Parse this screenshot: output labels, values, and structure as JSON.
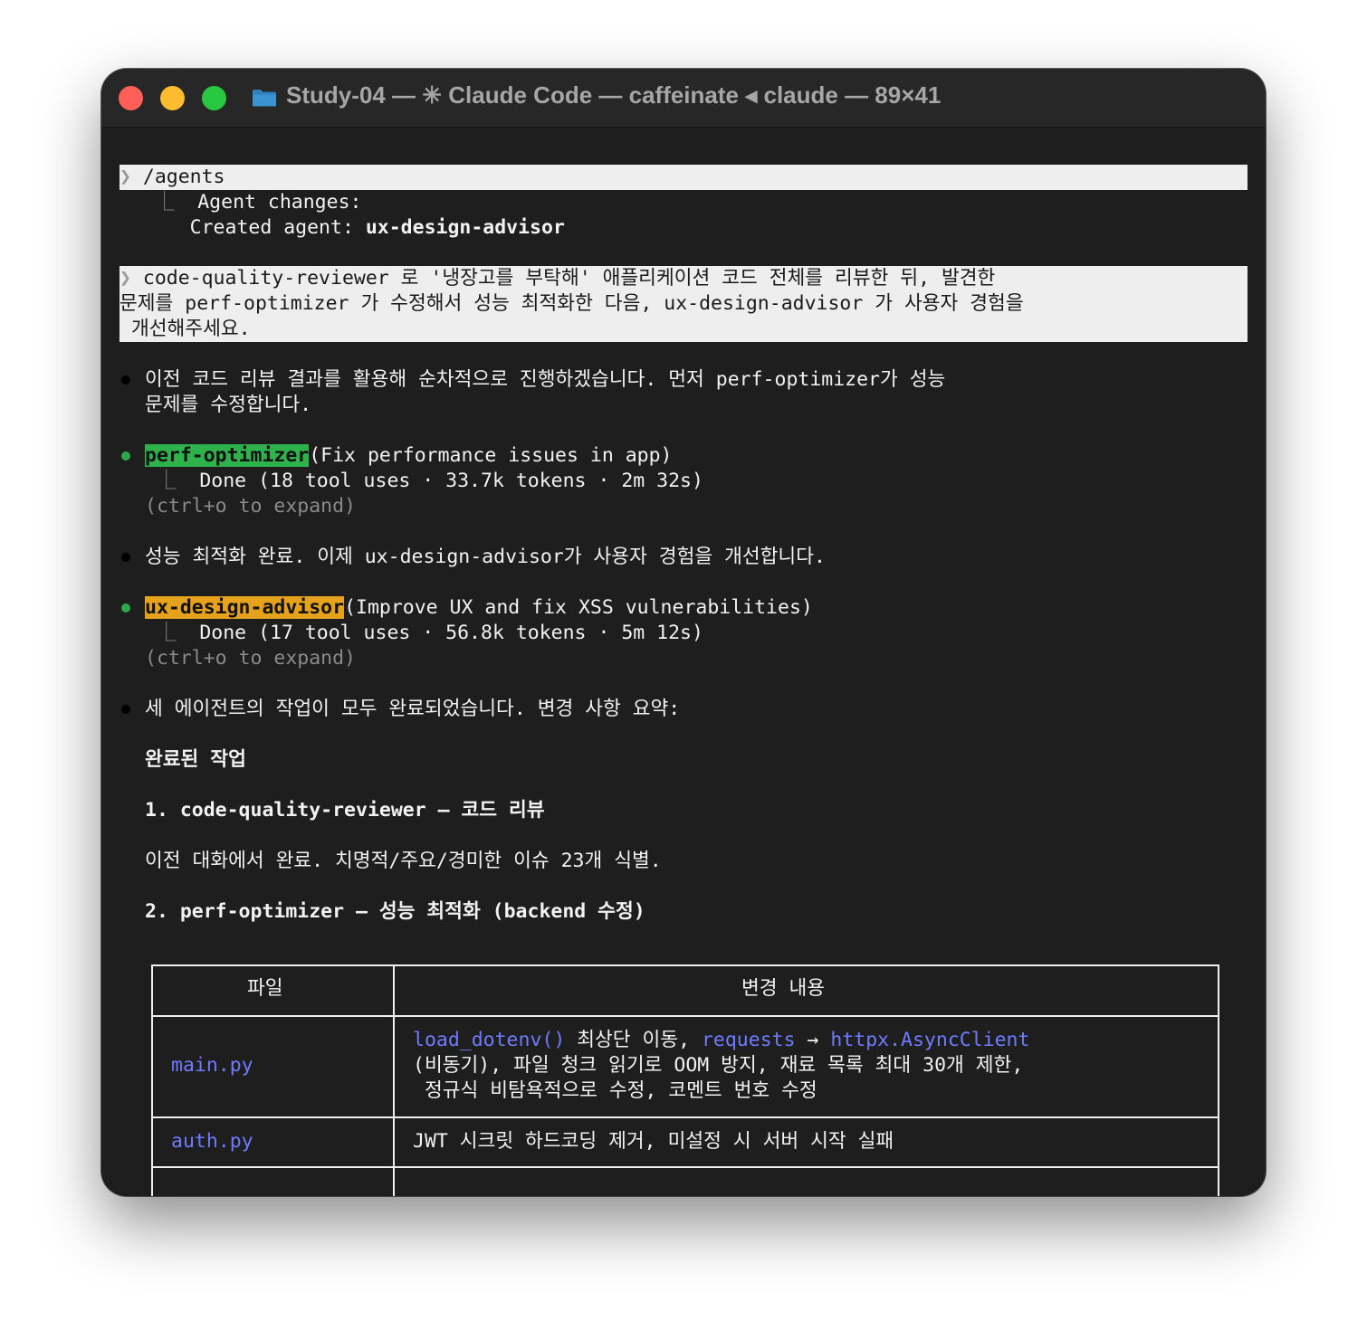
{
  "window": {
    "title": "Study-04 — ✳ Claude Code — caffeinate ◂ claude — 89×41"
  },
  "blocks": {
    "cmd1": "/agents",
    "agent_changes": "Agent changes:",
    "created_label": "Created agent: ",
    "created_name": "ux-design-advisor",
    "cmd2_l1": "code-quality-reviewer 로 '냉장고를 부탁해' 애플리케이션 코드 전체를 리뷰한 뒤, 발견한",
    "cmd2_l2": "문제를 perf-optimizer 가 수정해서 성능 최적화한 다음, ux-design-advisor 가 사용자 경험을",
    "cmd2_l3": " 개선해주세요.",
    "msg1_l1": "이전 코드 리뷰 결과를 활용해 순차적으로 진행하겠습니다. 먼저 perf-optimizer가 성능",
    "msg1_l2": "문제를 수정합니다.",
    "task1_name": "perf-optimizer",
    "task1_desc": "(Fix performance issues in app)",
    "task1_result": "Done (18 tool uses · 33.7k tokens · 2m 32s)",
    "expand_hint": "(ctrl+o to expand)",
    "msg2": "성능 최적화 완료. 이제 ux-design-advisor가 사용자 경험을 개선합니다.",
    "task2_name": "ux-design-advisor",
    "task2_desc": "(Improve UX and fix XSS vulnerabilities)",
    "task2_result": "Done (17 tool uses · 56.8k tokens · 5m 12s)",
    "msg3": "세 에이전트의 작업이 모두 완료되었습니다. 변경 사항 요약:",
    "h_done": "완료된 작업",
    "h1": "1. code-quality-reviewer — 코드 리뷰",
    "p1": "이전 대화에서 완료. 치명적/주요/경미한 이슈 23개 식별.",
    "h2": "2. perf-optimizer — 성능 최적화 (backend 수정)"
  },
  "table": {
    "headers": [
      "파일",
      "변경 내용"
    ],
    "rows": [
      {
        "file": "main.py",
        "code1": "load_dotenv()",
        "t1": " 최상단 이동, ",
        "code2": "requests",
        "arrow": " → ",
        "code3": "httpx.AsyncClient",
        "l2": "(비동기), 파일 청크 읽기로 OOM 방지, 재료 목록 최대 30개 제한,",
        "l3": " 정규식 비탐욕적으로 수정, 코멘트 번호 수정"
      },
      {
        "file": "auth.py",
        "change": "JWT 시크릿 하드코딩 제거, 미설정 시 서버 시작 실패"
      }
    ]
  }
}
